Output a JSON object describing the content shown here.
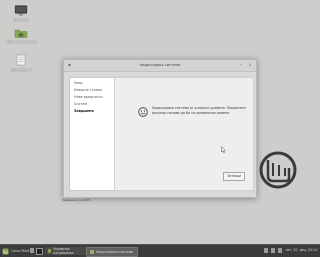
{
  "desktop": {
    "icons": [
      {
        "label": "Рачунар"
      },
      {
        "label": "Личне фасцикле"
      },
      {
        "label": "Документи"
      }
    ]
  },
  "dialog": {
    "title": "Надоградња система",
    "steps": [
      {
        "label": "Увод"
      },
      {
        "label": "Изворне ставке"
      },
      {
        "label": "Нове вредности"
      },
      {
        "label": "Систем"
      },
      {
        "label": "Завршено"
      }
    ],
    "active_step": "Завршено",
    "message": "Надоградња система је успешно урађена. Покрените рачунар поново да би се применили измене.",
    "done_label": "Затвори",
    "footer": "Завршено је 100%"
  },
  "panel": {
    "menu_label": "Linux Mint",
    "tasks": [
      {
        "label": "Управник ажурирања"
      },
      {
        "label": "Надоградња система"
      }
    ],
    "clock": "пет, 20. дец, 20:14"
  },
  "colors": {
    "desktop": "#cdcdcb",
    "panel": "#3c3c3b",
    "mint": "#87a556"
  }
}
